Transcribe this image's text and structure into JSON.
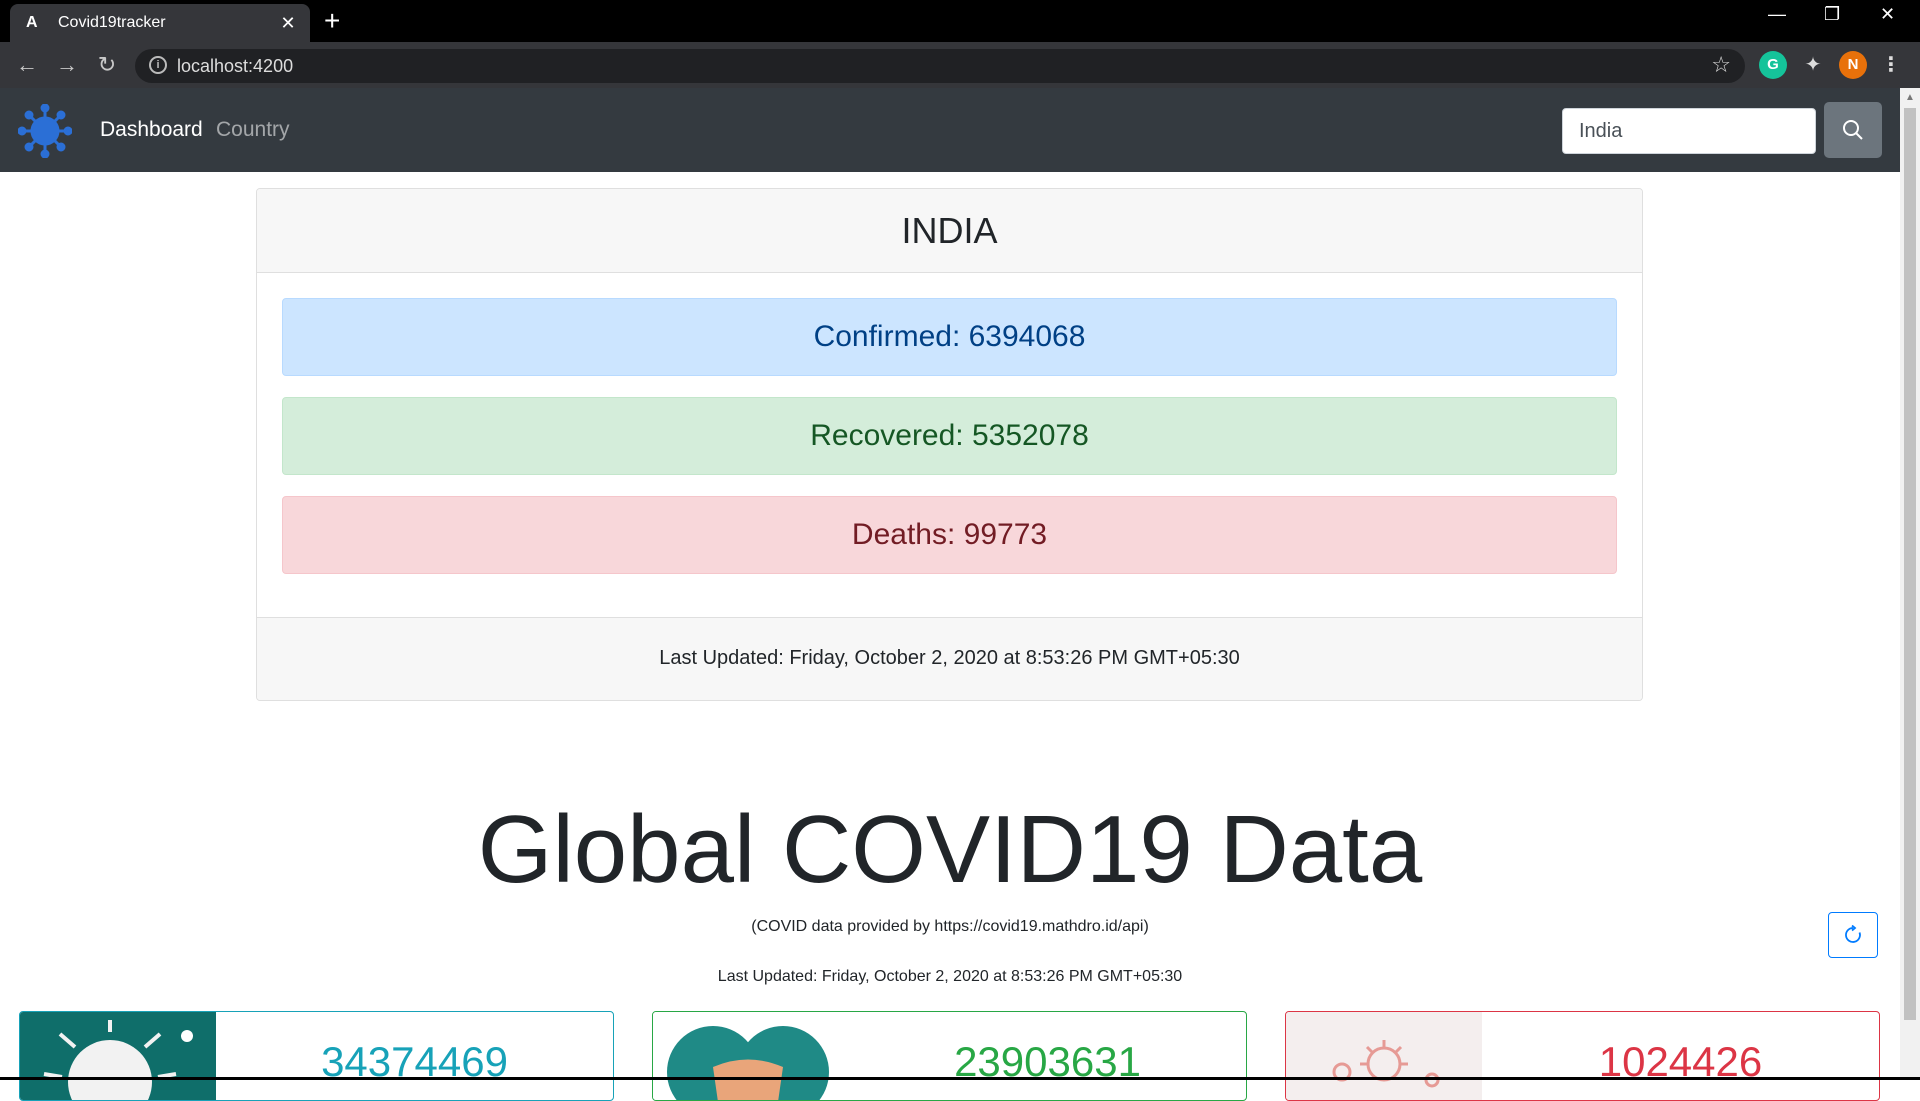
{
  "browser": {
    "tab_title": "Covid19tracker",
    "favicon_letter": "A",
    "url": "localhost:4200",
    "profile_initial": "N",
    "grammarly_initial": "G"
  },
  "navbar": {
    "links": [
      {
        "label": "Dashboard",
        "active": true
      },
      {
        "label": "Country",
        "active": false
      }
    ],
    "search_value": "India"
  },
  "country": {
    "name": "INDIA",
    "confirmed": "Confirmed: 6394068",
    "recovered": "Recovered: 5352078",
    "deaths": "Deaths: 99773",
    "last_updated": "Last Updated: Friday, October 2, 2020 at 8:53:26 PM GMT+05:30"
  },
  "global": {
    "title": "Global COVID19 Data",
    "source": "(COVID data provided by https://covid19.mathdro.id/api)",
    "last_updated": "Last Updated: Friday, October 2, 2020 at 8:53:26 PM GMT+05:30",
    "confirmed": "34374469",
    "recovered": "23903631",
    "deaths": "1024426"
  },
  "colors": {
    "navbar_bg": "#343a40",
    "confirmed": "#17a2b8",
    "recovered": "#28a745",
    "deaths": "#dc3545",
    "primary": "#007bff"
  }
}
